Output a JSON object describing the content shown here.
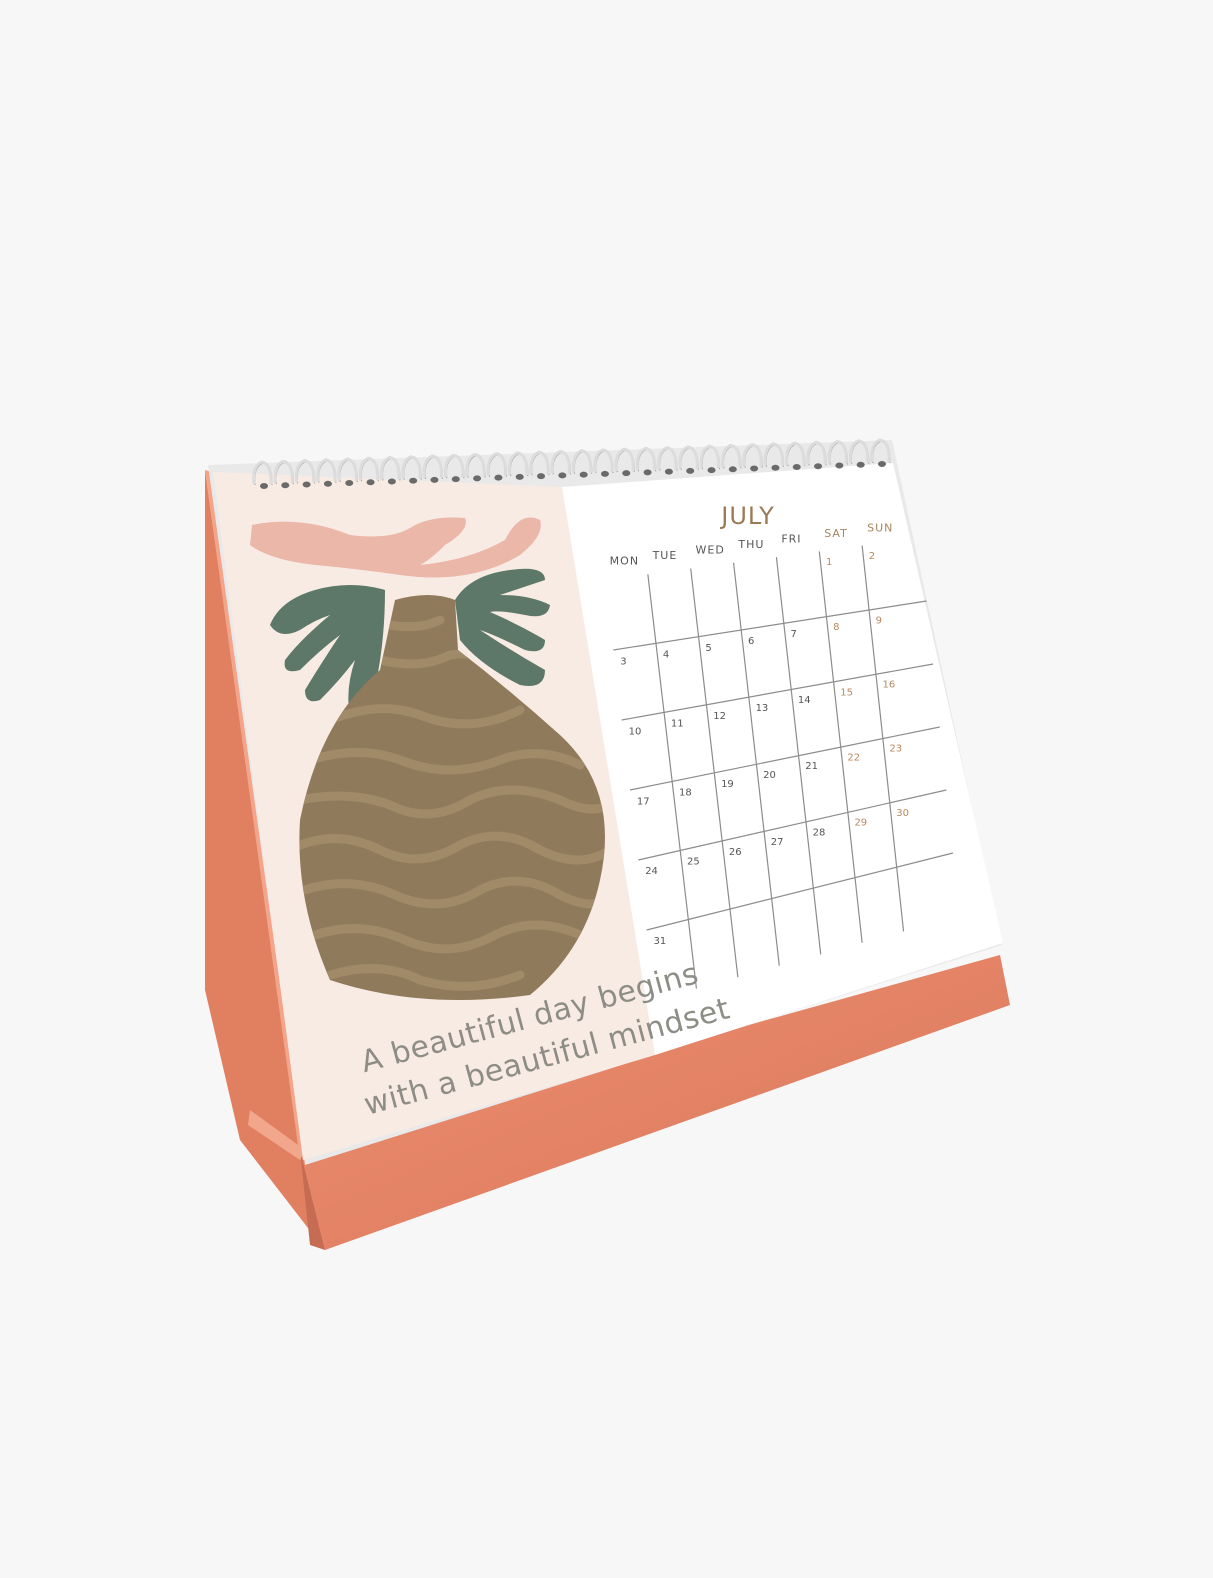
{
  "calendar": {
    "month": "JULY",
    "quote_line1": "A beautiful day begins",
    "quote_line2": "with a beautiful mindset",
    "day_names": [
      "MON",
      "TUE",
      "WED",
      "THU",
      "FRI",
      "SAT",
      "SUN"
    ],
    "weekend_days": [
      "SAT",
      "SUN"
    ],
    "weeks": [
      [
        "",
        "",
        "",
        "",
        "",
        "1",
        "2"
      ],
      [
        "3",
        "4",
        "5",
        "6",
        "7",
        "8",
        "9"
      ],
      [
        "10",
        "11",
        "12",
        "13",
        "14",
        "15",
        "16"
      ],
      [
        "17",
        "18",
        "19",
        "20",
        "21",
        "22",
        "23"
      ],
      [
        "24",
        "25",
        "26",
        "27",
        "28",
        "29",
        "30"
      ],
      [
        "31",
        "",
        "",
        "",
        "",
        "",
        ""
      ]
    ]
  },
  "colors": {
    "background": "#f7f7f7",
    "stand": "#e8876a",
    "stand_shadow": "#c9795f",
    "art_panel": "#f8ebe4",
    "vase": "#8f7a5b",
    "vase_stripe": "#a48d6b",
    "leaves": "#5d7868",
    "flower": "#eab7a8",
    "month": "#9a7b55"
  },
  "icons": [
    "spiral-binding",
    "vase-illustration",
    "leaf-illustration",
    "flower-illustration"
  ]
}
